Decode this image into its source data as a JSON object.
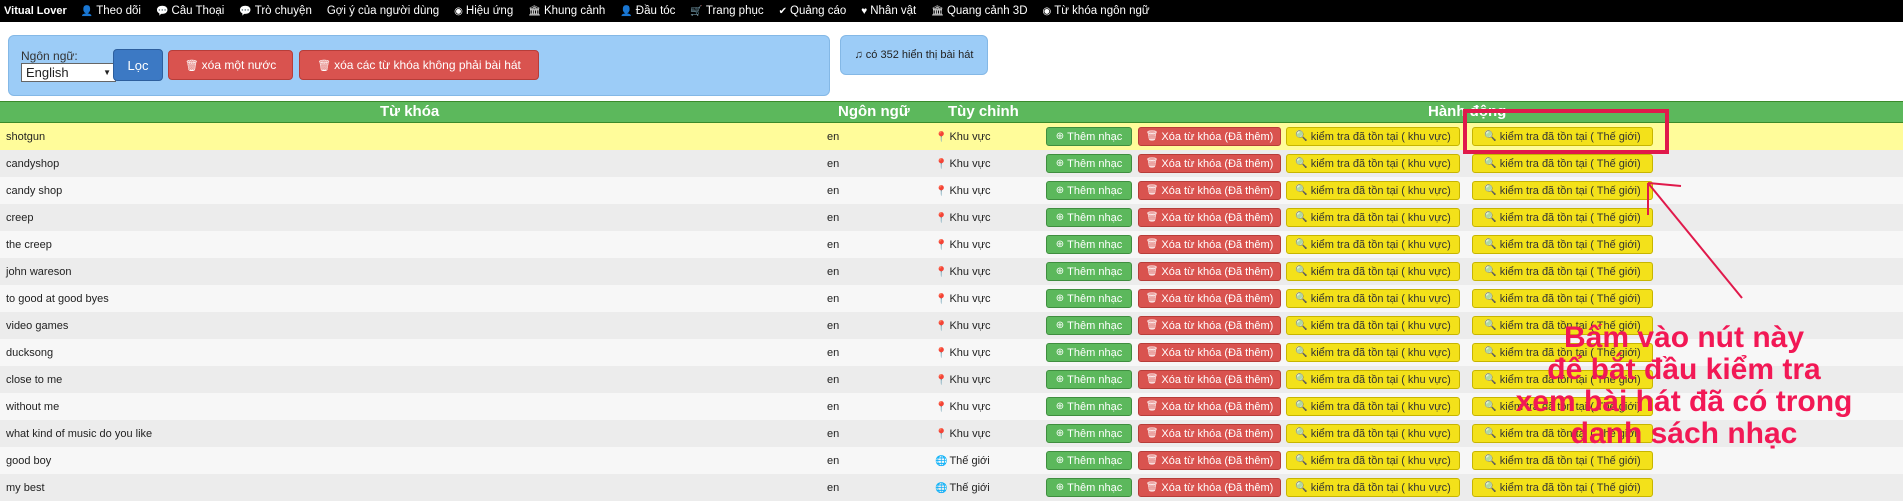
{
  "nav": {
    "brand": "Vitual Lover",
    "items": [
      {
        "icon": "👤",
        "label": "Theo dõi"
      },
      {
        "icon": "💬",
        "label": "Câu Thoại"
      },
      {
        "icon": "💬",
        "label": "Trò chuyện"
      },
      {
        "icon": "",
        "label": "Gợi ý của người dùng"
      },
      {
        "icon": "◉",
        "label": "Hiệu ứng"
      },
      {
        "icon": "🏛",
        "label": "Khung cảnh"
      },
      {
        "icon": "👤",
        "label": "Đầu tóc"
      },
      {
        "icon": "🛒",
        "label": "Trang phục"
      },
      {
        "icon": "✔",
        "label": "Quảng cáo"
      },
      {
        "icon": "♥",
        "label": "Nhân vật"
      },
      {
        "icon": "🏛",
        "label": "Quang cảnh 3D"
      },
      {
        "icon": "◉",
        "label": "Từ khóa ngôn ngữ"
      }
    ]
  },
  "filter": {
    "language_label": "Ngôn ngữ:",
    "language_value": "English",
    "filter_button": "Lọc",
    "delete_country_button": "xóa một nước",
    "delete_non_song_button": "xóa các từ khóa không phải bài hát"
  },
  "count_text": "có 352 hiển thị bài hát",
  "table": {
    "headers": {
      "keyword": "Từ khóa",
      "language": "Ngôn ngữ",
      "customize": "Tùy chỉnh",
      "actions": "Hành động"
    },
    "buttons": {
      "add_music": "Thêm nhạc",
      "delete_keyword": "Xóa từ khóa (Đã thêm)",
      "check_exists_region": "kiểm tra đã tồn tại ( khu vực)",
      "check_exists_world": "kiểm tra đã tồn tại ( Thế giới)"
    },
    "rows": [
      {
        "keyword": "shotgun",
        "language": "en",
        "scope": "Khu vực",
        "scope_icon": "map-marker-icon"
      },
      {
        "keyword": "candyshop",
        "language": "en",
        "scope": "Khu vực",
        "scope_icon": "map-marker-icon"
      },
      {
        "keyword": "candy shop",
        "language": "en",
        "scope": "Khu vực",
        "scope_icon": "map-marker-icon"
      },
      {
        "keyword": "creep",
        "language": "en",
        "scope": "Khu vực",
        "scope_icon": "map-marker-icon"
      },
      {
        "keyword": "the creep",
        "language": "en",
        "scope": "Khu vực",
        "scope_icon": "map-marker-icon"
      },
      {
        "keyword": "john wareson",
        "language": "en",
        "scope": "Khu vực",
        "scope_icon": "map-marker-icon"
      },
      {
        "keyword": "to good at good byes",
        "language": "en",
        "scope": "Khu vực",
        "scope_icon": "map-marker-icon"
      },
      {
        "keyword": "video games",
        "language": "en",
        "scope": "Khu vực",
        "scope_icon": "map-marker-icon"
      },
      {
        "keyword": "ducksong",
        "language": "en",
        "scope": "Khu vực",
        "scope_icon": "map-marker-icon"
      },
      {
        "keyword": "close to me",
        "language": "en",
        "scope": "Khu vực",
        "scope_icon": "map-marker-icon"
      },
      {
        "keyword": "without me",
        "language": "en",
        "scope": "Khu vực",
        "scope_icon": "map-marker-icon"
      },
      {
        "keyword": "what kind of music do you like",
        "language": "en",
        "scope": "Khu vực",
        "scope_icon": "map-marker-icon"
      },
      {
        "keyword": "good boy",
        "language": "en",
        "scope": "Thế giới",
        "scope_icon": "globe-icon"
      },
      {
        "keyword": "my best",
        "language": "en",
        "scope": "Thế giới",
        "scope_icon": "globe-icon"
      }
    ]
  },
  "annotation": {
    "lines": [
      "Bấm vào nút này",
      "để bắt đầu kiểm tra",
      "xem bài hát đã có trong",
      "danh sách nhạc"
    ],
    "color": "#f21855"
  }
}
